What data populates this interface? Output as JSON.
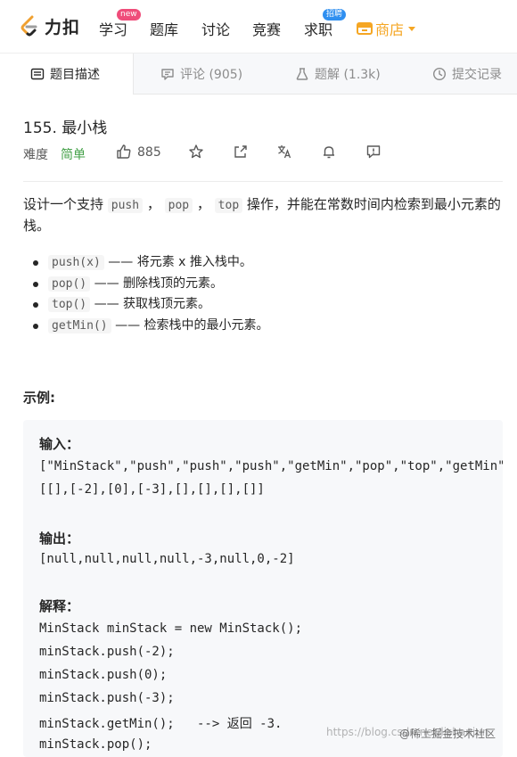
{
  "brand": {
    "name": "力扣",
    "accent": "#262626"
  },
  "nav": {
    "learn": "学习",
    "learn_badge": "new",
    "problems": "题库",
    "discuss": "讨论",
    "contest": "竞赛",
    "jobs": "求职",
    "jobs_badge": "招聘",
    "store": "商店",
    "store_color": "#f5a623"
  },
  "tabs": {
    "description": "题目描述",
    "comments": "评论 (905)",
    "solutions": "题解 (1.3k)",
    "submissions": "提交记录"
  },
  "problem": {
    "title": "155. 最小栈",
    "difficulty_label": "难度",
    "difficulty": "简单",
    "difficulty_color": "#43a047",
    "likes": "885",
    "desc_1": "设计一个支持 ",
    "code_push": "push",
    "sep1": " ， ",
    "code_pop": "pop",
    "sep2": " ， ",
    "code_top": "top",
    "desc_2": " 操作，并能在常数时间内检索到最小元素的栈。",
    "bullets": [
      {
        "code": "push(x)",
        "text": " —— 将元素 x 推入栈中。"
      },
      {
        "code": "pop()",
        "text": " —— 删除栈顶的元素。"
      },
      {
        "code": "top()",
        "text": " —— 获取栈顶元素。"
      },
      {
        "code": "getMin()",
        "text": " —— 检索栈中的最小元素。"
      }
    ],
    "example_label": "示例:"
  },
  "example": {
    "input_label": "输入：",
    "input_line1": "[\"MinStack\",\"push\",\"push\",\"push\",\"getMin\",\"pop\",\"top\",\"getMin\"]",
    "input_line2": "[[],[-2],[0],[-3],[],[],[],[]]",
    "output_label": "输出：",
    "output_line": "[null,null,null,null,-3,null,0,-2]",
    "explain_label": "解释：",
    "code_lines": [
      "MinStack minStack = new MinStack();",
      "minStack.push(-2);",
      "minStack.push(0);",
      "minStack.push(-3);",
      "minStack.getMin();   --> 返回 -3.",
      "minStack.pop();"
    ]
  },
  "watermark": {
    "url": "https://blog.csdn.net/lishanjun",
    "logo": "@稀土掘金技术社区"
  }
}
